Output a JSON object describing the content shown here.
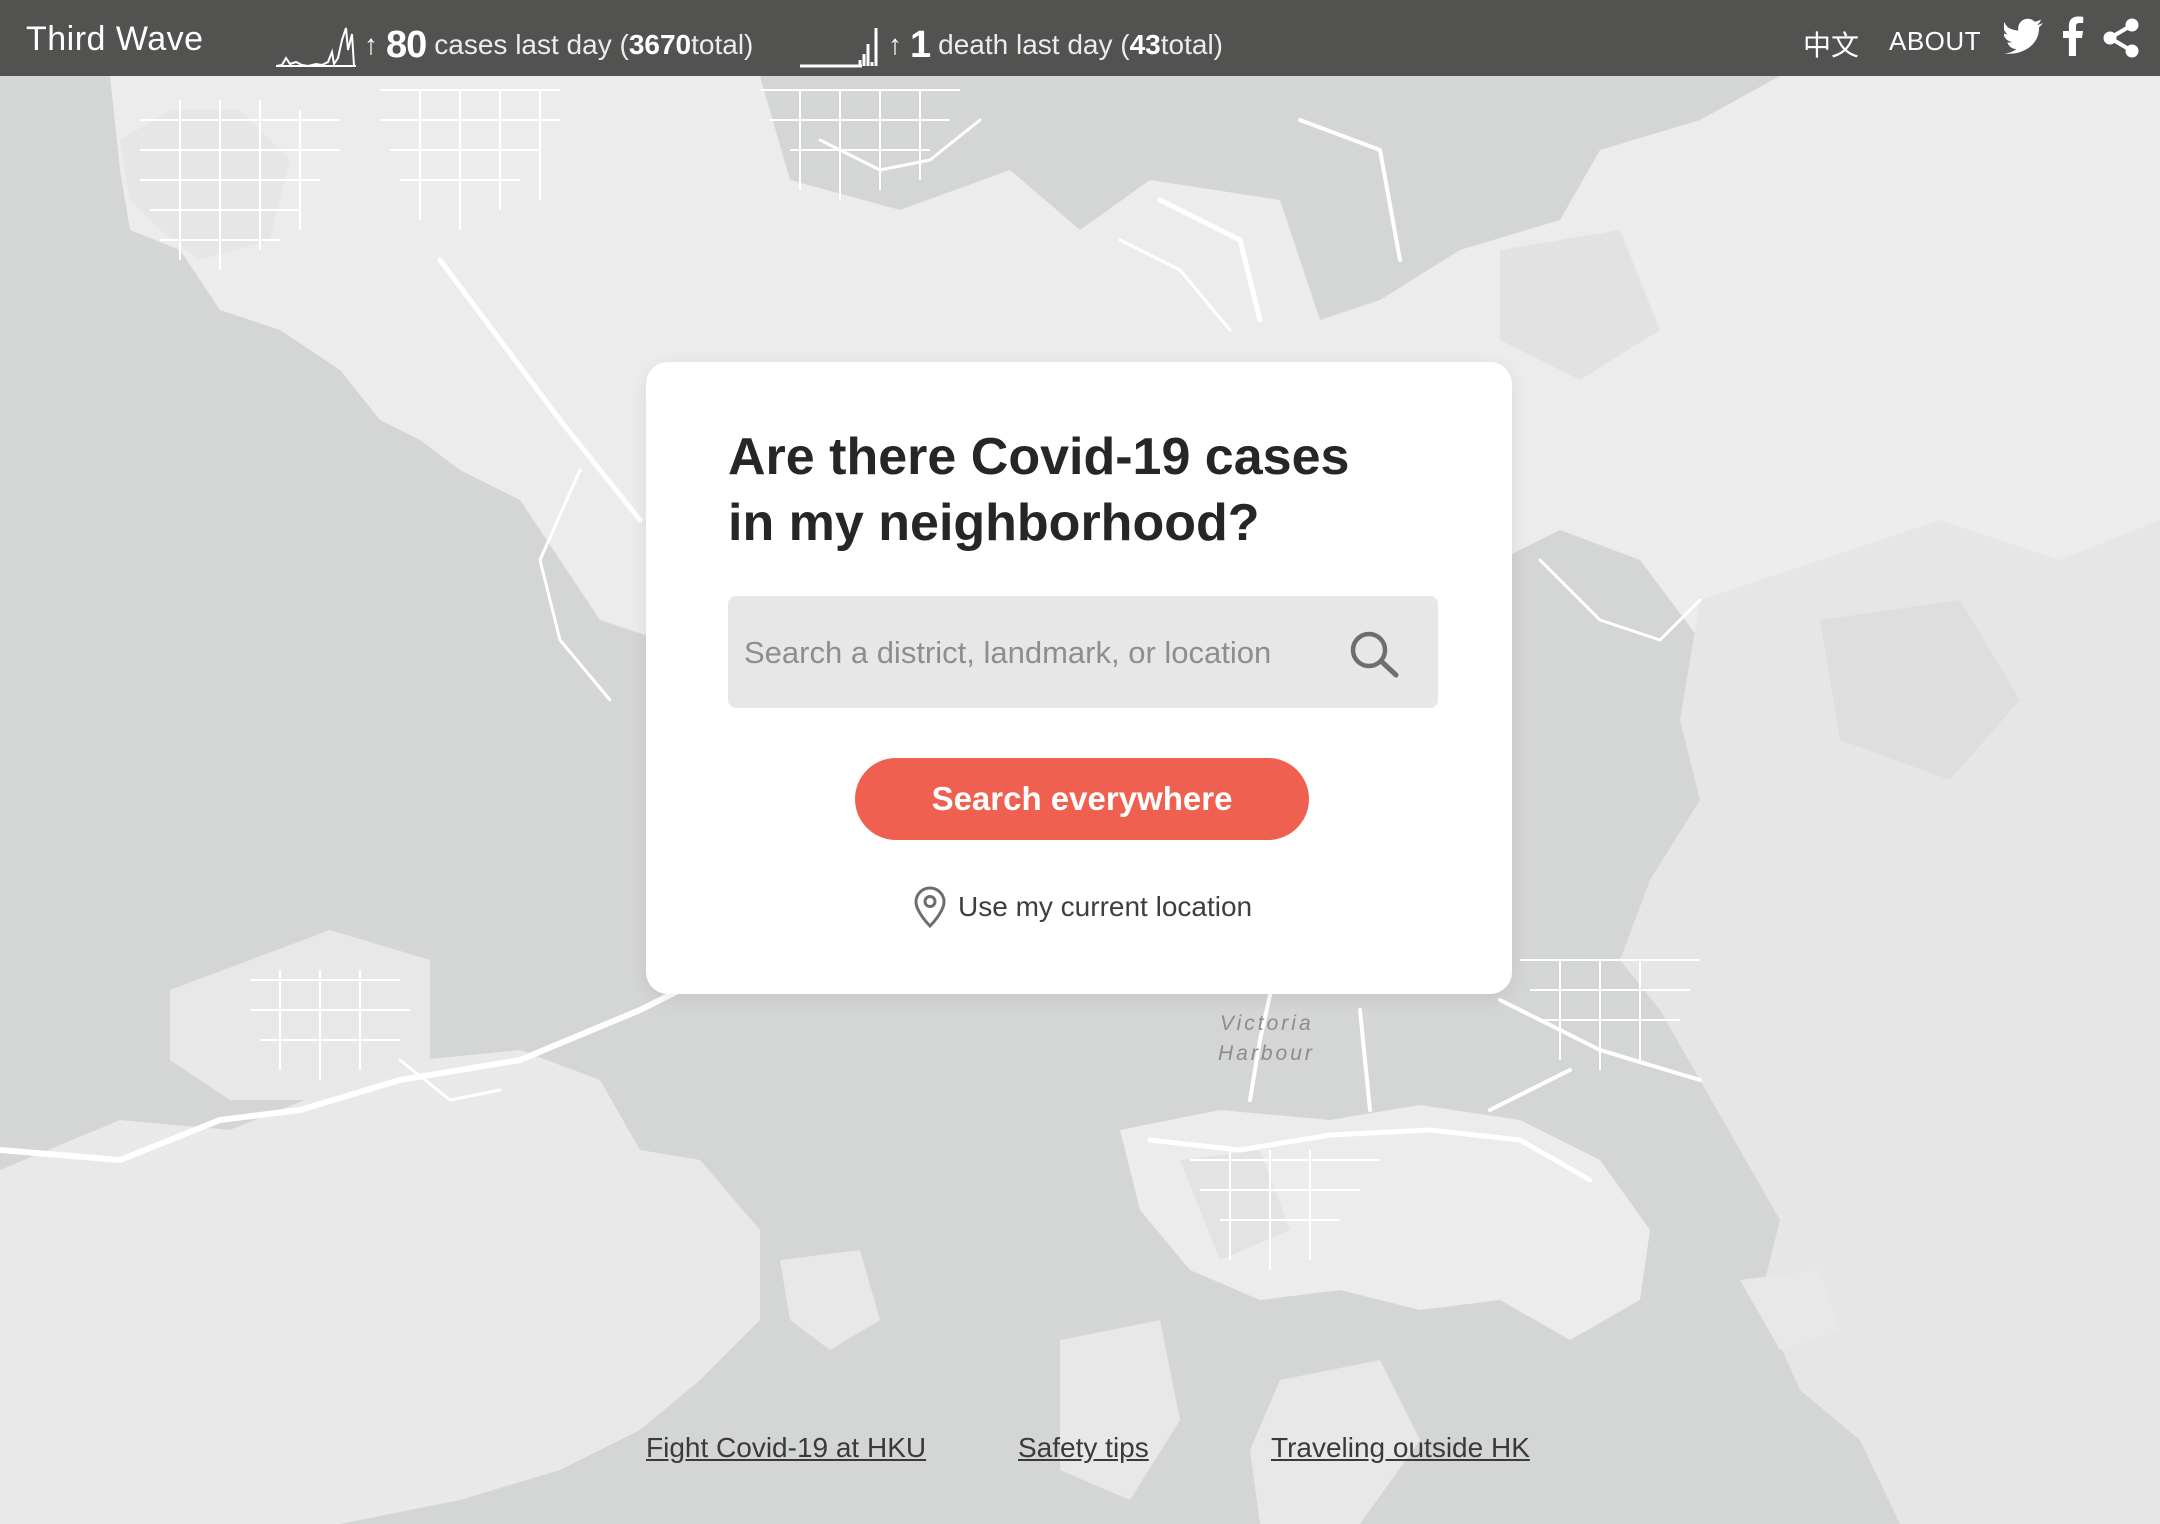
{
  "header": {
    "brand": "Third Wave",
    "cases": {
      "arrow": "↑",
      "count": "80",
      "label": "cases last day (",
      "total": "3670",
      "suffix": " total)"
    },
    "deaths": {
      "arrow": "↑",
      "count": "1",
      "label": "death last day (",
      "total": "43",
      "suffix": " total)"
    },
    "lang_label": "中文",
    "about_label": "ABOUT",
    "icons": [
      "twitter-icon",
      "facebook-icon",
      "share-icon"
    ]
  },
  "card": {
    "title_line1": "Are there Covid-19 cases",
    "title_line2": "in my neighborhood?",
    "search_placeholder": "Search a district, landmark, or location",
    "search_value": "",
    "cta_label": "Search everywhere",
    "location_label": "Use my current location"
  },
  "map": {
    "label_line1": "Victoria",
    "label_line2": "Harbour",
    "colors": {
      "water": "#d4d5d5",
      "land": "#efefef",
      "roads": "#ffffff"
    }
  },
  "footer": {
    "links": [
      "Fight Covid-19 at HKU",
      "Safety tips",
      "Traveling outside HK"
    ]
  },
  "colors": {
    "topbar": "#525251",
    "accent": "#f06050",
    "card": "#ffffff"
  }
}
